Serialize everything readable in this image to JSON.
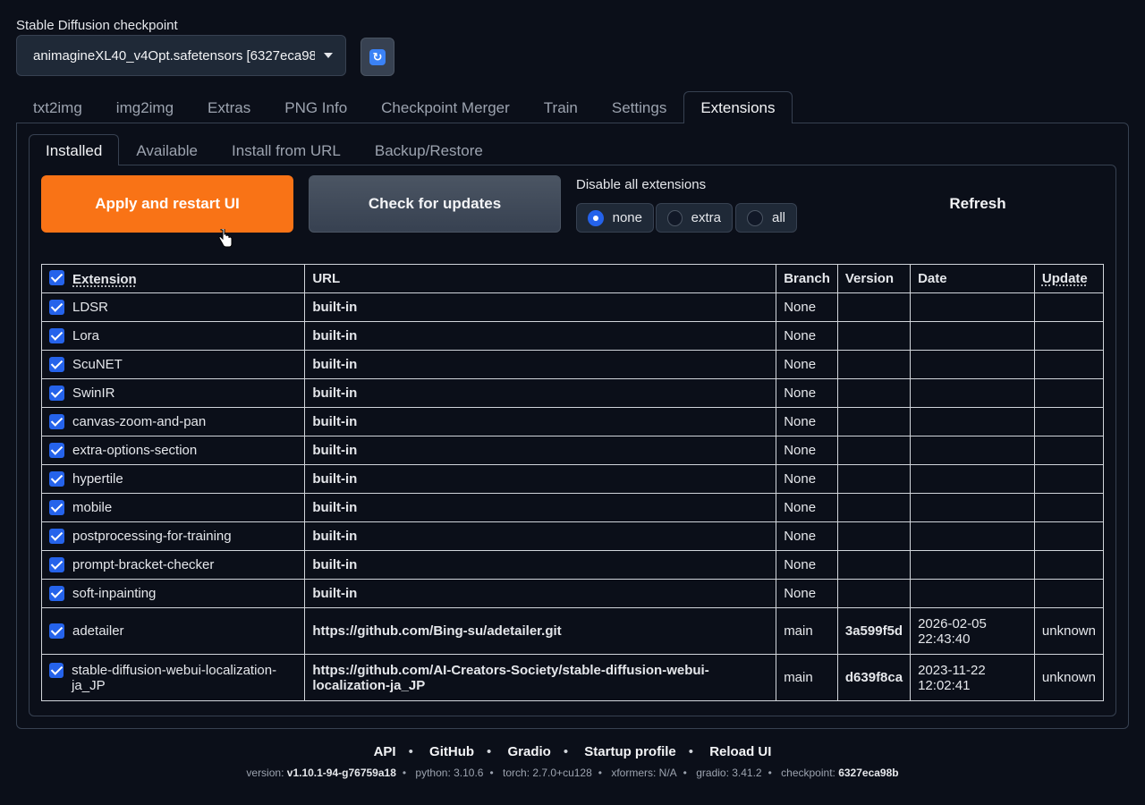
{
  "checkpoint": {
    "label": "Stable Diffusion checkpoint",
    "value": "animagineXL40_v4Opt.safetensors [6327eca98t",
    "refresh_icon": "refresh-icon"
  },
  "main_tabs": [
    "txt2img",
    "img2img",
    "Extras",
    "PNG Info",
    "Checkpoint Merger",
    "Train",
    "Settings",
    "Extensions"
  ],
  "sub_tabs": [
    "Installed",
    "Available",
    "Install from URL",
    "Backup/Restore"
  ],
  "buttons": {
    "apply": "Apply and restart UI",
    "check": "Check for updates",
    "refresh": "Refresh"
  },
  "disable": {
    "label": "Disable all extensions",
    "options": [
      "none",
      "extra",
      "all"
    ],
    "selected": "none"
  },
  "table": {
    "headers": [
      "Extension",
      "URL",
      "Branch",
      "Version",
      "Date",
      "Update"
    ],
    "rows": [
      {
        "name": "LDSR",
        "url": "built-in",
        "branch": "None",
        "version": "",
        "date1": "",
        "date2": "",
        "update": ""
      },
      {
        "name": "Lora",
        "url": "built-in",
        "branch": "None",
        "version": "",
        "date1": "",
        "date2": "",
        "update": ""
      },
      {
        "name": "ScuNET",
        "url": "built-in",
        "branch": "None",
        "version": "",
        "date1": "",
        "date2": "",
        "update": ""
      },
      {
        "name": "SwinIR",
        "url": "built-in",
        "branch": "None",
        "version": "",
        "date1": "",
        "date2": "",
        "update": ""
      },
      {
        "name": "canvas-zoom-and-pan",
        "url": "built-in",
        "branch": "None",
        "version": "",
        "date1": "",
        "date2": "",
        "update": ""
      },
      {
        "name": "extra-options-section",
        "url": "built-in",
        "branch": "None",
        "version": "",
        "date1": "",
        "date2": "",
        "update": ""
      },
      {
        "name": "hypertile",
        "url": "built-in",
        "branch": "None",
        "version": "",
        "date1": "",
        "date2": "",
        "update": ""
      },
      {
        "name": "mobile",
        "url": "built-in",
        "branch": "None",
        "version": "",
        "date1": "",
        "date2": "",
        "update": ""
      },
      {
        "name": "postprocessing-for-training",
        "url": "built-in",
        "branch": "None",
        "version": "",
        "date1": "",
        "date2": "",
        "update": ""
      },
      {
        "name": "prompt-bracket-checker",
        "url": "built-in",
        "branch": "None",
        "version": "",
        "date1": "",
        "date2": "",
        "update": ""
      },
      {
        "name": "soft-inpainting",
        "url": "built-in",
        "branch": "None",
        "version": "",
        "date1": "",
        "date2": "",
        "update": ""
      },
      {
        "name": "adetailer",
        "url": "https://github.com/Bing-su/adetailer.git",
        "branch": "main",
        "version": "3a599f5d",
        "date1": "2026-02-05",
        "date2": "22:43:40",
        "update": "unknown"
      },
      {
        "name": "stable-diffusion-webui-localization-ja_JP",
        "url": "https://github.com/AI-Creators-Society/stable-diffusion-webui-localization-ja_JP",
        "branch": "main",
        "version": "d639f8ca",
        "date1": "2023-11-22",
        "date2": "12:02:41",
        "update": "unknown"
      }
    ]
  },
  "footer": {
    "links": [
      "API",
      "GitHub",
      "Gradio",
      "Startup profile",
      "Reload UI"
    ],
    "version_label": "version:",
    "version": "v1.10.1-94-g76759a18",
    "python": "python: 3.10.6",
    "torch": "torch: 2.7.0+cu128",
    "xformers": "xformers: N/A",
    "gradio": "gradio: 3.41.2",
    "checkpoint_label": "checkpoint:",
    "checkpoint": "6327eca98b"
  }
}
